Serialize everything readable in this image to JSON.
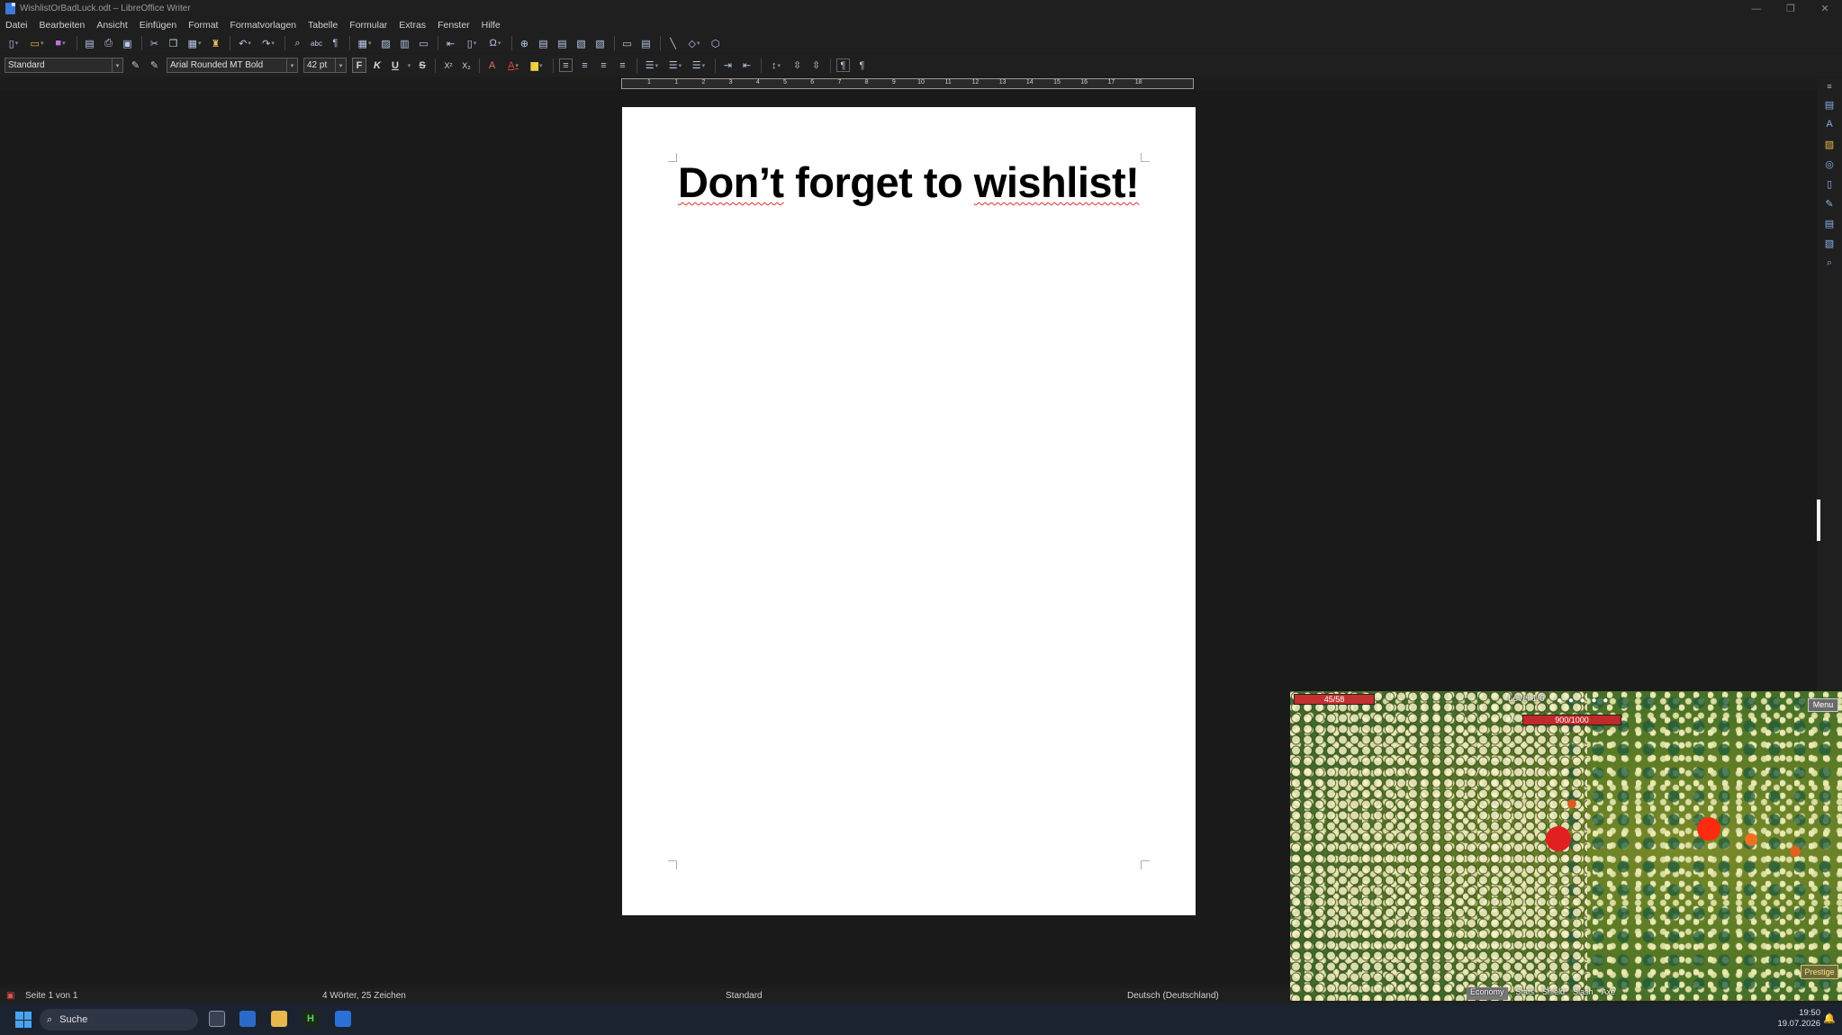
{
  "window": {
    "title": "WishlistOrBadLuck.odt – LibreOffice Writer",
    "controls": [
      "—",
      "❐",
      "✕"
    ]
  },
  "menu": [
    "Datei",
    "Bearbeiten",
    "Ansicht",
    "Einfügen",
    "Format",
    "Formatvorlagen",
    "Tabelle",
    "Formular",
    "Extras",
    "Fenster",
    "Hilfe"
  ],
  "formatting": {
    "paragraph_style": "Standard",
    "font_name": "Arial Rounded MT Bold",
    "font_size": "42 pt",
    "bold": "F",
    "italic": "K",
    "underline": "U",
    "strike": "S",
    "superscript": "X²",
    "subscript": "X₂"
  },
  "ruler": {
    "ticks": [
      "1",
      "1",
      "2",
      "3",
      "4",
      "5",
      "6",
      "7",
      "8",
      "9",
      "10",
      "11",
      "12",
      "13",
      "14",
      "15",
      "16",
      "17",
      "18"
    ]
  },
  "document": {
    "heading_words": [
      "Don’t",
      "forget",
      "to",
      "wishlist!"
    ]
  },
  "statusbar": {
    "page": "Seite 1 von 1",
    "words": "4 Wörter, 25 Zeichen",
    "style": "Standard",
    "language": "Deutsch (Deutschland)"
  },
  "game": {
    "hp": "45/58",
    "level": "Level 1/6",
    "level_dots": "● ● ● ● ●",
    "boss_hp": "900/1000",
    "menu_label": "Menu",
    "prestige_label": "Prestige",
    "tabs": [
      "Economy",
      "Stats",
      "Shield",
      "Slash",
      "Axe"
    ],
    "colors": {
      "health": "#c43030",
      "grass": "#5a7a25",
      "horde": "#f2f2c4"
    }
  },
  "taskbar": {
    "search_label": "Suche",
    "time": "19:50",
    "date": "19.07.2026"
  },
  "colors": {
    "accent": "#3b78d8",
    "spell_error": "#e03030",
    "background": "#1c1c1c"
  }
}
